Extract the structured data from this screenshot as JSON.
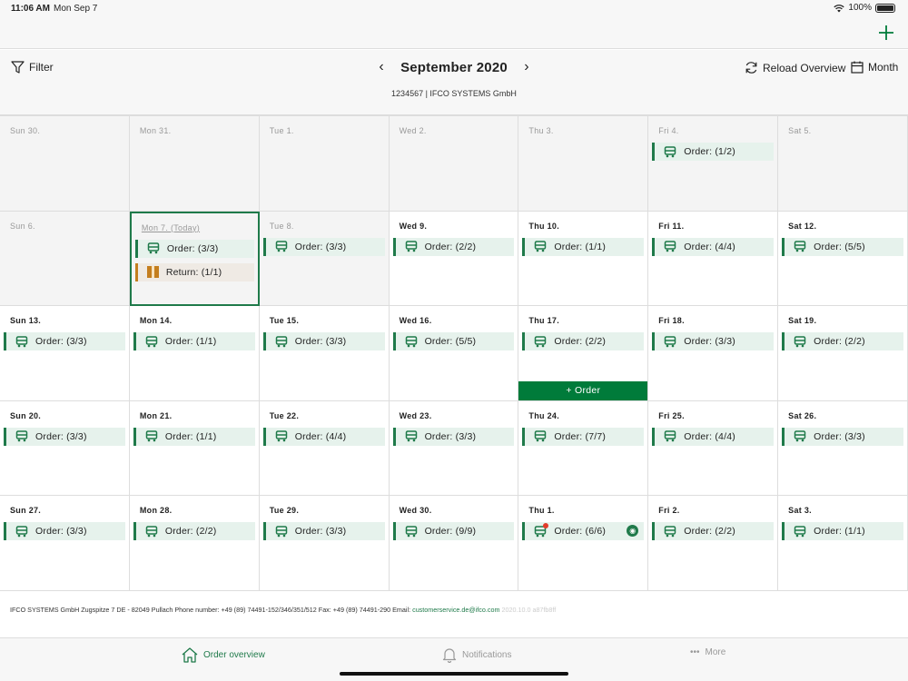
{
  "status_bar": {
    "time": "11:06 AM",
    "date": "Mon Sep 7",
    "battery": "100%"
  },
  "toolbar": {
    "filter_label": "Filter",
    "month_title": "September 2020",
    "account": "1234567 | IFCO SYSTEMS GmbH",
    "reload_label": "Reload Overview",
    "view_label": "Month"
  },
  "calendar": {
    "weeks": [
      [
        {
          "label": "Sun 30.",
          "entries": []
        },
        {
          "label": "Mon 31.",
          "entries": []
        },
        {
          "label": "Tue 1.",
          "entries": []
        },
        {
          "label": "Wed 2.",
          "entries": []
        },
        {
          "label": "Thu 3.",
          "entries": []
        },
        {
          "label": "Fri 4.",
          "entries": [
            {
              "kind": "order",
              "text": "Order: (1/2)"
            }
          ]
        },
        {
          "label": "Sat 5.",
          "entries": []
        }
      ],
      [
        {
          "label": "Sun 6.",
          "entries": []
        },
        {
          "label": "Mon 7. (Today)",
          "entries": [
            {
              "kind": "order",
              "text": "Order: (3/3)"
            },
            {
              "kind": "return",
              "text": "Return: (1/1)"
            }
          ]
        },
        {
          "label": "Tue 8.",
          "entries": [
            {
              "kind": "order",
              "text": "Order: (3/3)"
            }
          ]
        },
        {
          "label": "Wed 9.",
          "entries": [
            {
              "kind": "order",
              "text": "Order: (2/2)"
            }
          ]
        },
        {
          "label": "Thu 10.",
          "entries": [
            {
              "kind": "order",
              "text": "Order: (1/1)"
            }
          ]
        },
        {
          "label": "Fri 11.",
          "entries": [
            {
              "kind": "order",
              "text": "Order: (4/4)"
            }
          ]
        },
        {
          "label": "Sat 12.",
          "entries": [
            {
              "kind": "order",
              "text": "Order: (5/5)"
            }
          ]
        }
      ],
      [
        {
          "label": "Sun 13.",
          "entries": [
            {
              "kind": "order",
              "text": "Order: (3/3)"
            }
          ]
        },
        {
          "label": "Mon 14.",
          "entries": [
            {
              "kind": "order",
              "text": "Order: (1/1)"
            }
          ]
        },
        {
          "label": "Tue 15.",
          "entries": [
            {
              "kind": "order",
              "text": "Order: (3/3)"
            }
          ]
        },
        {
          "label": "Wed 16.",
          "entries": [
            {
              "kind": "order",
              "text": "Order: (5/5)"
            }
          ]
        },
        {
          "label": "Thu 17.",
          "entries": [
            {
              "kind": "order",
              "text": "Order: (2/2)"
            }
          ],
          "add_order": "+ Order"
        },
        {
          "label": "Fri 18.",
          "entries": [
            {
              "kind": "order",
              "text": "Order: (3/3)"
            }
          ]
        },
        {
          "label": "Sat 19.",
          "entries": [
            {
              "kind": "order",
              "text": "Order: (2/2)"
            }
          ]
        }
      ],
      [
        {
          "label": "Sun 20.",
          "entries": [
            {
              "kind": "order",
              "text": "Order: (3/3)"
            }
          ]
        },
        {
          "label": "Mon 21.",
          "entries": [
            {
              "kind": "order",
              "text": "Order: (1/1)"
            }
          ]
        },
        {
          "label": "Tue 22.",
          "entries": [
            {
              "kind": "order",
              "text": "Order: (4/4)"
            }
          ]
        },
        {
          "label": "Wed 23.",
          "entries": [
            {
              "kind": "order",
              "text": "Order: (3/3)"
            }
          ]
        },
        {
          "label": "Thu 24.",
          "entries": [
            {
              "kind": "order",
              "text": "Order: (7/7)"
            }
          ]
        },
        {
          "label": "Fri 25.",
          "entries": [
            {
              "kind": "order",
              "text": "Order: (4/4)"
            }
          ]
        },
        {
          "label": "Sat 26.",
          "entries": [
            {
              "kind": "order",
              "text": "Order: (3/3)"
            }
          ]
        }
      ],
      [
        {
          "label": "Sun 27.",
          "entries": [
            {
              "kind": "order",
              "text": "Order: (3/3)"
            }
          ]
        },
        {
          "label": "Mon 28.",
          "entries": [
            {
              "kind": "order",
              "text": "Order: (2/2)"
            }
          ]
        },
        {
          "label": "Tue 29.",
          "entries": [
            {
              "kind": "order",
              "text": "Order: (3/3)"
            }
          ]
        },
        {
          "label": "Wed 30.",
          "entries": [
            {
              "kind": "order",
              "text": "Order: (9/9)"
            }
          ]
        },
        {
          "label": "Thu 1.",
          "entries": [
            {
              "kind": "order",
              "text": "Order: (6/6)",
              "notification": true,
              "rss": true
            }
          ]
        },
        {
          "label": "Fri 2.",
          "entries": [
            {
              "kind": "order",
              "text": "Order: (2/2)"
            }
          ]
        },
        {
          "label": "Sat 3.",
          "entries": [
            {
              "kind": "order",
              "text": "Order: (1/1)"
            }
          ]
        }
      ]
    ]
  },
  "footer": {
    "text": "IFCO SYSTEMS GmbH Zugspitze 7 DE - 82049 Pullach Phone number: +49 (89) 74491-152/346/351/512 Fax: +49 (89) 74491-290 Email:",
    "email": "customerservice.de@ifco.com",
    "version": "2020.10.0 a87fb8ff"
  },
  "tabbar": {
    "tabs": [
      {
        "label": "Order overview",
        "active": true
      },
      {
        "label": "Notifications",
        "active": false
      },
      {
        "label": "More",
        "active": false
      }
    ]
  },
  "colors": {
    "accent": "#007b3a",
    "order_bg": "#e6f2ec",
    "return_accent": "#c47e1e"
  }
}
